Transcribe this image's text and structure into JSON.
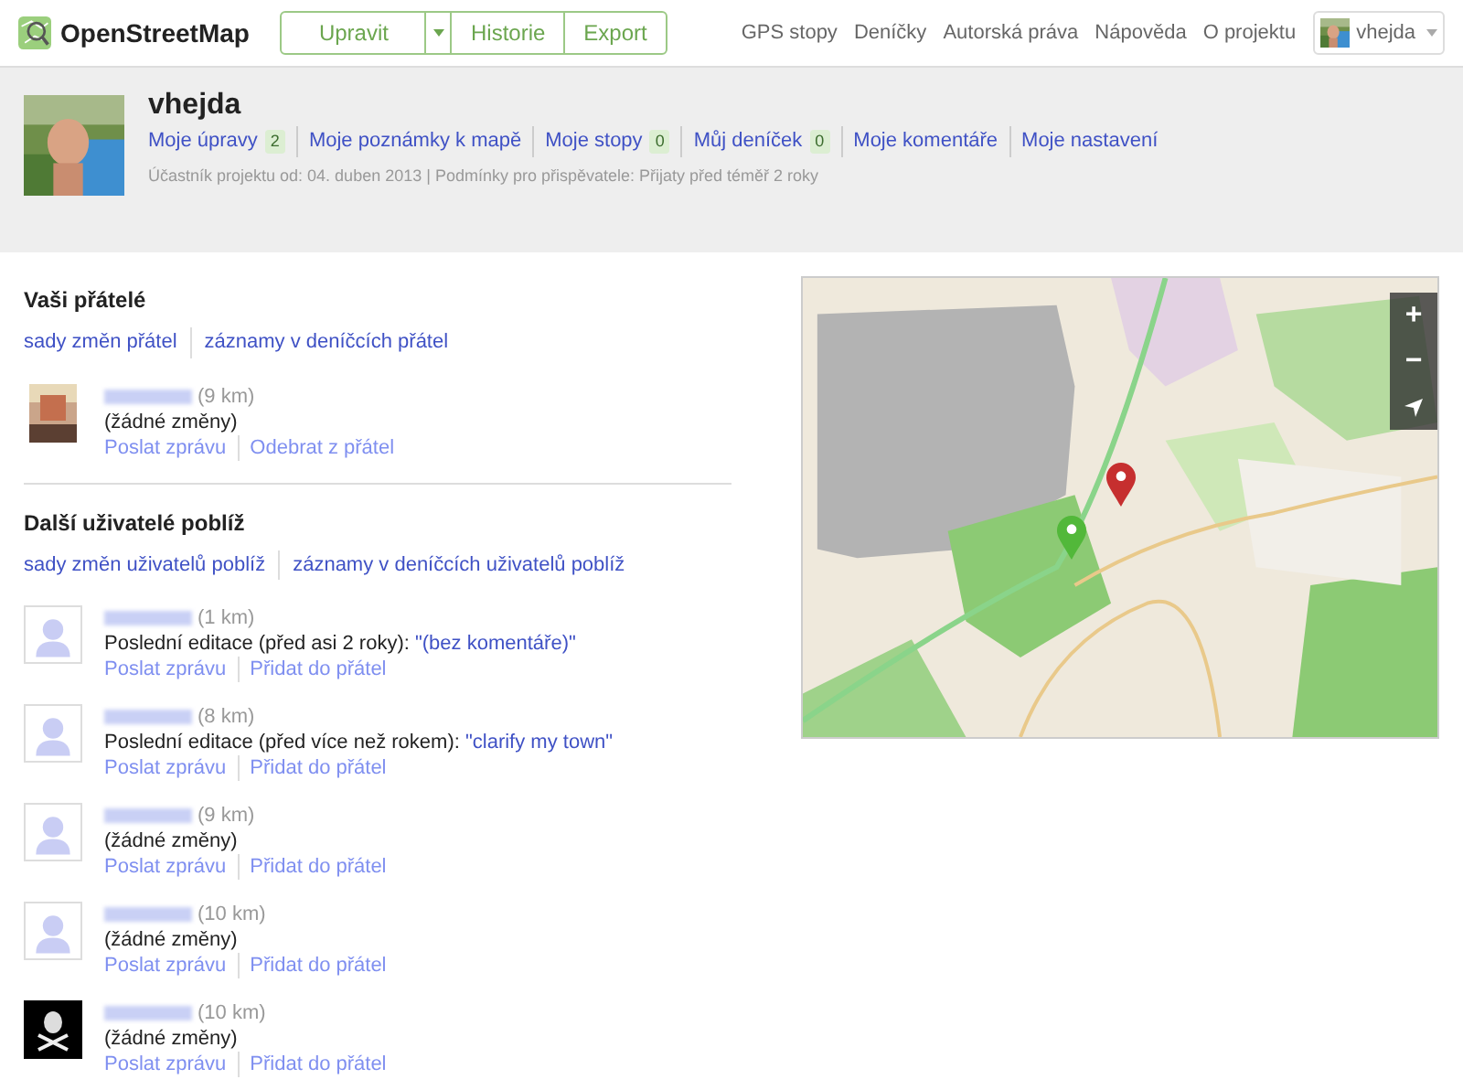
{
  "navbar": {
    "brand": "OpenStreetMap",
    "edit_buttons": [
      {
        "label": "Upravit",
        "kind": "text"
      },
      {
        "kind": "caret"
      },
      {
        "label": "Historie",
        "kind": "text"
      },
      {
        "label": "Export",
        "kind": "text"
      }
    ],
    "links": [
      "GPS stopy",
      "Deníčky",
      "Autorská práva",
      "Nápověda",
      "O projektu"
    ],
    "user_menu": "vhejda"
  },
  "profile": {
    "name": "vhejda",
    "links": [
      {
        "label": "Moje úpravy",
        "count": "2"
      },
      {
        "label": "Moje poznámky k mapě"
      },
      {
        "label": "Moje stopy",
        "count": "0"
      },
      {
        "label": "Můj deníček",
        "count": "0"
      },
      {
        "label": "Moje komentáře"
      },
      {
        "label": "Moje nastavení"
      }
    ],
    "info": "Účastník projektu od: 04. duben 2013 | Podmínky pro přispěvatele: Přijaty před téměř 2 roky"
  },
  "friends": {
    "title": "Vaši přátelé",
    "links": [
      "sady změn přátel",
      "záznamy v deníčcích přátel"
    ],
    "users": [
      {
        "distance": "(9 km)",
        "status": "(žádné změny)",
        "actions": [
          "Poslat zprávu",
          "Odebrat z přátel"
        ]
      }
    ]
  },
  "nearby": {
    "title": "Další uživatelé poblíž",
    "links": [
      "sady změn uživatelů poblíž",
      "záznamy v deníčcích uživatelů poblíž"
    ],
    "users": [
      {
        "avatar": {
          "kind": "default"
        },
        "distance": "(1 km)",
        "status": "Poslední editace (před asi 2 roky): ",
        "comment": "\"(bez komentáře)\"",
        "actions": [
          "Poslat zprávu",
          "Přidat do přátel"
        ]
      },
      {
        "avatar": {
          "kind": "default"
        },
        "distance": "(8 km)",
        "status": "Poslední editace (před více než rokem): ",
        "comment": "\"clarify my town\"",
        "actions": [
          "Poslat zprávu",
          "Přidat do přátel"
        ]
      },
      {
        "avatar": {
          "kind": "default"
        },
        "distance": "(9 km)",
        "status": "(žádné změny)",
        "actions": [
          "Poslat zprávu",
          "Přidat do přátel"
        ]
      },
      {
        "avatar": {
          "kind": "default"
        },
        "distance": "(10 km)",
        "status": "(žádné změny)",
        "actions": [
          "Poslat zprávu",
          "Přidat do přátel"
        ]
      },
      {
        "avatar": {
          "kind": "crossbones"
        },
        "distance": "(10 km)",
        "status": "(žádné změny)",
        "actions": [
          "Poslat zprávu",
          "Přidat do přátel"
        ]
      }
    ]
  },
  "map": {
    "zoom_controls": [
      "+",
      "−"
    ],
    "markers": [
      {
        "color": "#c62f2f"
      },
      {
        "color": "#52b83a"
      }
    ]
  }
}
